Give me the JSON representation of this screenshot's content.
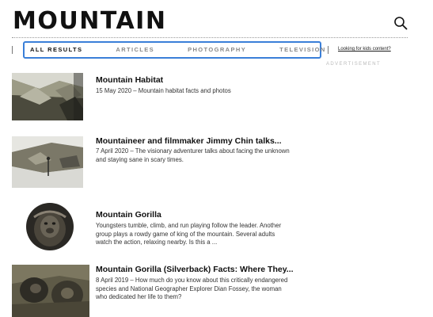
{
  "header": {
    "title": "MOUNTAIN",
    "search_icon": "search-icon"
  },
  "tabs": [
    {
      "label": "ALL RESULTS",
      "active": true
    },
    {
      "label": "ARTICLES",
      "active": false
    },
    {
      "label": "PHOTOGRAPHY",
      "active": false
    },
    {
      "label": "TELEVISION",
      "active": false
    }
  ],
  "kids_link": "Looking for kids content?",
  "advertisement_label": "ADVERTISEMENT",
  "results": [
    {
      "title": "Mountain Habitat",
      "meta": "15 May 2020 – Mountain habitat facts and photos"
    },
    {
      "title": "Mountaineer and filmmaker Jimmy Chin talks...",
      "meta": "7 April 2020 – The visionary adventurer talks about facing the unknown and staying sane in scary times."
    },
    {
      "title": "Mountain Gorilla",
      "meta": "Youngsters tumble, climb, and run playing follow the leader. Another group plays a rowdy game of king of the mountain. Several adults watch the action, relaxing nearby. Is this a ..."
    },
    {
      "title": "Mountain Gorilla (Silverback) Facts: Where They...",
      "meta": "8 April 2019 – How much do you know about this critically endangered species and National Geographer Explorer Dian Fossey, the woman who dedicated her life to them?"
    }
  ],
  "colors": {
    "tab_focus_border": "#3a7fd8",
    "text": "#111111",
    "muted": "#888888"
  }
}
